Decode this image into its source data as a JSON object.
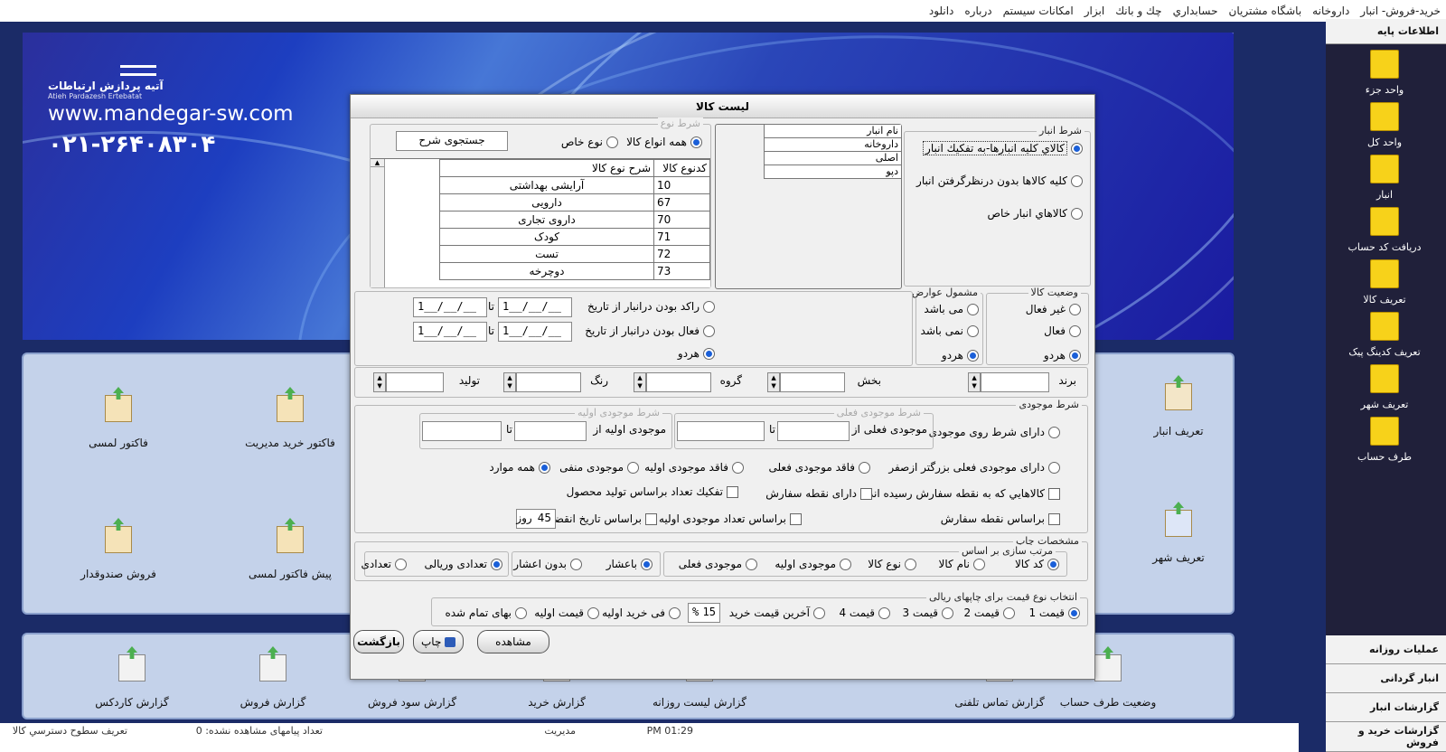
{
  "menubar": [
    "خريد-فروش- انبار",
    "داروخانه",
    "باشگاه مشتريان",
    "حسابداري",
    "چك و بانك",
    "ابزار",
    "امكانات سيستم",
    "درباره",
    "دانلود"
  ],
  "sidebar": {
    "header": "اطلاعات پايه",
    "items": [
      {
        "label": "واحد جزء",
        "icon": "unit-part-icon"
      },
      {
        "label": "واحد کل",
        "icon": "unit-whole-icon"
      },
      {
        "label": "انبار",
        "icon": "warehouse-icon"
      },
      {
        "label": "دریافت کد حساب",
        "icon": "account-code-icon"
      },
      {
        "label": "تعریف کالا",
        "icon": "product-define-icon"
      },
      {
        "label": "تعریف کدینگ پیک",
        "icon": "courier-icon"
      },
      {
        "label": "تعریف شهر",
        "icon": "city-map-icon"
      },
      {
        "label": "طرف حساب",
        "icon": "contact-icon"
      }
    ],
    "sections": [
      "عملیات روزانه",
      "انبار گردانی",
      "گزارشات انبار",
      "گزارشات خرید و فروش"
    ]
  },
  "banner": {
    "company_fa": "آتیه پردازش ارتباطات",
    "company_en": "Atieh Pardazesh Ertebatat",
    "website": "www.mandegar-sw.com",
    "phone": "۰۲۱-۲۶۴۰۸۳۰۴"
  },
  "panel1": {
    "tiles": [
      "فاکتور لمسی",
      "فاکتور خرید مدیریت",
      "فروش صندوقدار",
      "پیش فاکتور لمسی",
      "تعریف انبار",
      "تعریف شهر"
    ]
  },
  "panel2": {
    "tiles": [
      "گزارش کاردکس",
      "گزارش فروش",
      "گزارش سود فروش",
      "گزارش خرید",
      "گزارش لیست روزانه",
      "گزارش تماس تلفنی",
      "وضعیت طرف حساب"
    ]
  },
  "statusbar": {
    "access": "تعريف سطوح دسترسي كالا",
    "messages": "تعداد پیامهای مشاهده نشده: 0",
    "user": "مدیریت",
    "time": "01:29 PM"
  },
  "dialog": {
    "title": "لیست کالا",
    "warehouse": {
      "legend": "شرط انبار",
      "opt1": "كالاي كليه انبارها-به تفكيك انبار",
      "opt2": "كليه كالاها بدون درنظرگرفتن انبار",
      "opt3": "كالاهاي انبار خاص",
      "list_header": "نام انبار",
      "list": [
        "داروخانه",
        "اصلی",
        "دپو"
      ]
    },
    "type": {
      "legend": "شرط نوع",
      "all": "همه انواع کالا",
      "special": "نوع خاص",
      "search_btn": "جستجوی شرح",
      "col_code": "کدنوع کالا",
      "col_desc": "شرح نوع کالا",
      "rows": [
        {
          "code": "10",
          "desc": "آرایشی بهداشتی"
        },
        {
          "code": "67",
          "desc": "دارویی"
        },
        {
          "code": "70",
          "desc": "داروی تجاری"
        },
        {
          "code": "71",
          "desc": "کودک"
        },
        {
          "code": "72",
          "desc": "تست"
        },
        {
          "code": "73",
          "desc": "دوچرخه"
        }
      ]
    },
    "dates": {
      "stagnant": "راکد بودن درانبار از تاریخ",
      "active": "فعال بودن درانبار از تاریخ",
      "to": "تا",
      "both": "هردو",
      "date_value": "1__/__/__"
    },
    "duties": {
      "legend": "مشمول عوارض",
      "yes": "می باشد",
      "no": "نمی باشد",
      "both": "هردو"
    },
    "status": {
      "legend": "وضعیت کالا",
      "inactive": "غیر فعال",
      "active": "فعال",
      "both": "هردو"
    },
    "filters": {
      "brand": "برند",
      "section": "بخش",
      "group": "گروه",
      "color": "رنگ",
      "production": "تولید"
    },
    "stock": {
      "legend": "شرط موجودی",
      "current_legend": "شرط موجودی فعلی",
      "initial_legend": "شرط موجودی اولیه",
      "has_cond": "دارای شرط روی موجودی",
      "current_from": "موجودی فعلی از",
      "initial_from": "موجودی اولیه از",
      "to": "تا",
      "gt_min": "دارای موجودی فعلی بزرگتر ازصفر",
      "no_current": "فاقد موجودی فعلی",
      "no_initial": "فاقد موجودی اولیه",
      "negative": "موجودی منفی",
      "all": "همه موارد",
      "reached_order": "كالاهايي كه به نقطه سفارش رسيده اند",
      "has_order_point": "دارای نقطه سفارش",
      "split_prod": "تفكيك تعداد براساس تولید محصول",
      "by_order_point": "براساس نقطه سفارش",
      "by_initial_count": "براساس تعداد موجودی اولیه",
      "by_expiry": "براساس تاریخ انقضاء",
      "days_value": "45",
      "days_unit": "روز"
    },
    "print": {
      "legend": "مشخصات چاپ",
      "sort_legend": "مرتب سازی بر اساس",
      "sort": [
        "کد کالا",
        "نام کالا",
        "نوع کالا",
        "موجودی اولیه",
        "موجودی فعلی"
      ],
      "decimal": [
        "باعشار",
        "بدون اعشار"
      ],
      "count": [
        "تعدادی وریالی",
        "تعدادی"
      ]
    },
    "price": {
      "legend": "انتخاب نوع قیمت برای چاپهای ریالی",
      "opts": [
        "قیمت 1",
        "قیمت 2",
        "قیمت 3",
        "قیمت 4",
        "آخرین قیمت خرید",
        "فی خرید اولیه",
        "قیمت اولیه",
        "بهای تمام شده"
      ],
      "percent": "15",
      "percent_sign": "%"
    },
    "buttons": {
      "view": "مشاهده",
      "print": "چاپ",
      "back": "بازگشت"
    }
  }
}
